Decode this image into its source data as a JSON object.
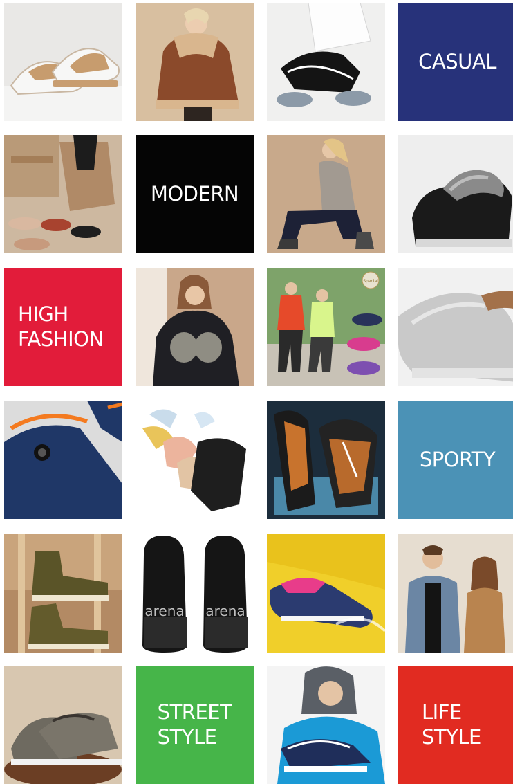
{
  "grid": {
    "labels": {
      "casual": "CASUAL",
      "modern": "MODERN",
      "high_fashion": "HIGH\nFASHION",
      "sporty": "SPORTY",
      "street_style": "STREET\nSTYLE",
      "life_style": "LIFE\nSTYLE"
    },
    "colors": {
      "casual": "#27327a",
      "modern": "#050505",
      "high_fashion": "#e21c3a",
      "sporty": "#4b92b6",
      "street_style": "#46b549",
      "life_style": "#e12b21"
    },
    "shoe_brand_text": "arena",
    "badge_text": "Special"
  }
}
